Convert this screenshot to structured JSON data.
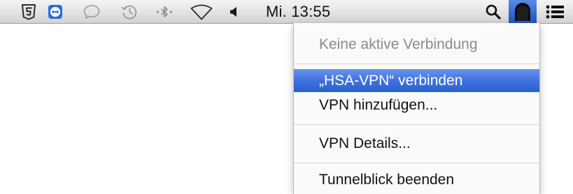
{
  "menubar": {
    "clock": "Mi. 13:55",
    "icons": [
      "html5-shield-icon",
      "teamviewer-icon",
      "speech-bubble-icon",
      "time-machine-icon",
      "bluetooth-icon",
      "wifi-icon",
      "volume-icon",
      "spotlight-search-icon",
      "tunnelblick-icon",
      "notification-list-icon"
    ]
  },
  "menu": {
    "status": "Keine aktive Verbindung",
    "connect": "„HSA-VPN“ verbinden",
    "add_vpn": "VPN hinzufügen...",
    "details": "VPN Details...",
    "quit": "Tunnelblick beenden"
  },
  "colors": {
    "highlight": "#3f72e0",
    "disabled_text": "#8a8a8a",
    "active_icon_bg": "#3568d4"
  }
}
